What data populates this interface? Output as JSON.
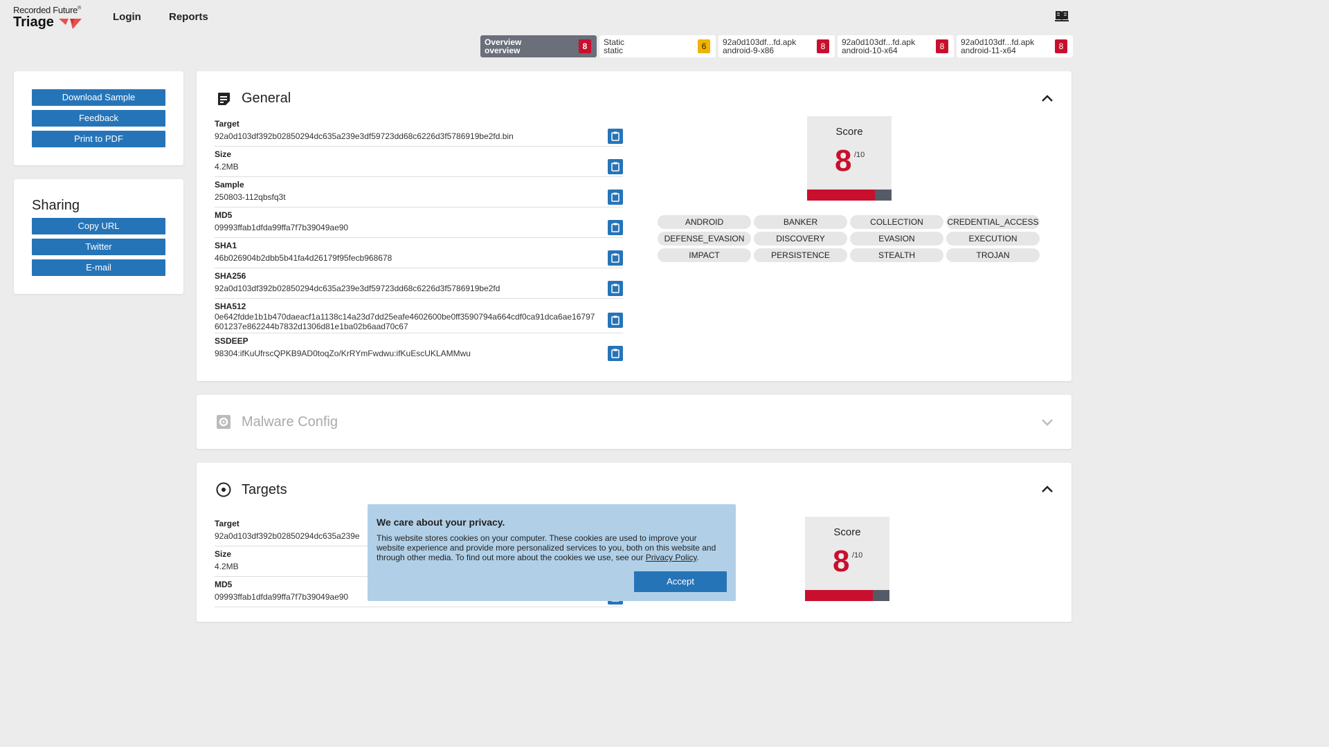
{
  "header": {
    "brand_company": "Recorded Future",
    "brand_trademark": "®",
    "brand_product": "Triage",
    "nav": [
      "Login",
      "Reports"
    ],
    "docs_icon": "book-icon"
  },
  "tabs": [
    {
      "title": "Overview",
      "subtitle": "overview",
      "score": "8",
      "badge_color": "#c8102e",
      "active": true
    },
    {
      "title": "Static",
      "subtitle": "static",
      "score": "6",
      "badge_color": "#f0b400",
      "active": false
    },
    {
      "title": "92a0d103df...fd.apk",
      "subtitle": "android-9-x86",
      "score": "8",
      "badge_color": "#c8102e",
      "active": false
    },
    {
      "title": "92a0d103df...fd.apk",
      "subtitle": "android-10-x64",
      "score": "8",
      "badge_color": "#c8102e",
      "active": false
    },
    {
      "title": "92a0d103df...fd.apk",
      "subtitle": "android-11-x64",
      "score": "8",
      "badge_color": "#c8102e",
      "active": false
    }
  ],
  "sidebar": {
    "actions": [
      "Download Sample",
      "Feedback",
      "Print to PDF"
    ],
    "sharing_title": "Sharing",
    "sharing": [
      "Copy URL",
      "Twitter",
      "E-mail"
    ]
  },
  "general": {
    "title": "General",
    "fields": [
      {
        "label": "Target",
        "value": "92a0d103df392b02850294dc635a239e3df59723dd68c6226d3f5786919be2fd.bin"
      },
      {
        "label": "Size",
        "value": "4.2MB"
      },
      {
        "label": "Sample",
        "value": "250803-112qbsfq3t"
      },
      {
        "label": "MD5",
        "value": "09993ffab1dfda99ffa7f7b39049ae90"
      },
      {
        "label": "SHA1",
        "value": "46b026904b2dbb5b41fa4d26179f95fecb968678"
      },
      {
        "label": "SHA256",
        "value": "92a0d103df392b02850294dc635a239e3df59723dd68c6226d3f5786919be2fd"
      },
      {
        "label": "SHA512",
        "value": "0e642fdde1b1b470daeacf1a1138c14a23d7dd25eafe4602600be0ff3590794a664cdf0ca91dca6ae16797601237e862244b7832d1306d81e1ba02b6aad70c67"
      },
      {
        "label": "SSDEEP",
        "value": "98304:ifKuUfrscQPKB9AD0toqZo/KrRYmFwdwu:ifKuEscUKLAMMwu"
      }
    ],
    "score_label": "Score",
    "score": "8",
    "score_max": "/10",
    "score_fraction": 0.8,
    "tags": [
      "ANDROID",
      "BANKER",
      "COLLECTION",
      "CREDENTIAL_ACCESS",
      "DEFENSE_EVASION",
      "DISCOVERY",
      "EVASION",
      "EXECUTION",
      "IMPACT",
      "PERSISTENCE",
      "STEALTH",
      "TROJAN"
    ]
  },
  "malware_config": {
    "title": "Malware Config"
  },
  "targets": {
    "title": "Targets",
    "fields": [
      {
        "label": "Target",
        "value": "92a0d103df392b02850294dc635a239e"
      },
      {
        "label": "Size",
        "value": "4.2MB"
      },
      {
        "label": "MD5",
        "value": "09993ffab1dfda99ffa7f7b39049ae90"
      }
    ],
    "score_label": "Score",
    "score": "8",
    "score_max": "/10",
    "score_fraction": 0.8
  },
  "cookie": {
    "title": "We care about your privacy.",
    "text": "This website stores cookies on your computer. These cookies are used to improve your website experience and provide more personalized services to you, both on this website and through other media. To find out more about the cookies we use, see our ",
    "link": "Privacy Policy",
    "text_end": ".",
    "accept": "Accept"
  },
  "colors": {
    "accent": "#2674b8",
    "danger": "#c8102e",
    "warning": "#f0b400",
    "tab_active": "#6b6f7a"
  }
}
